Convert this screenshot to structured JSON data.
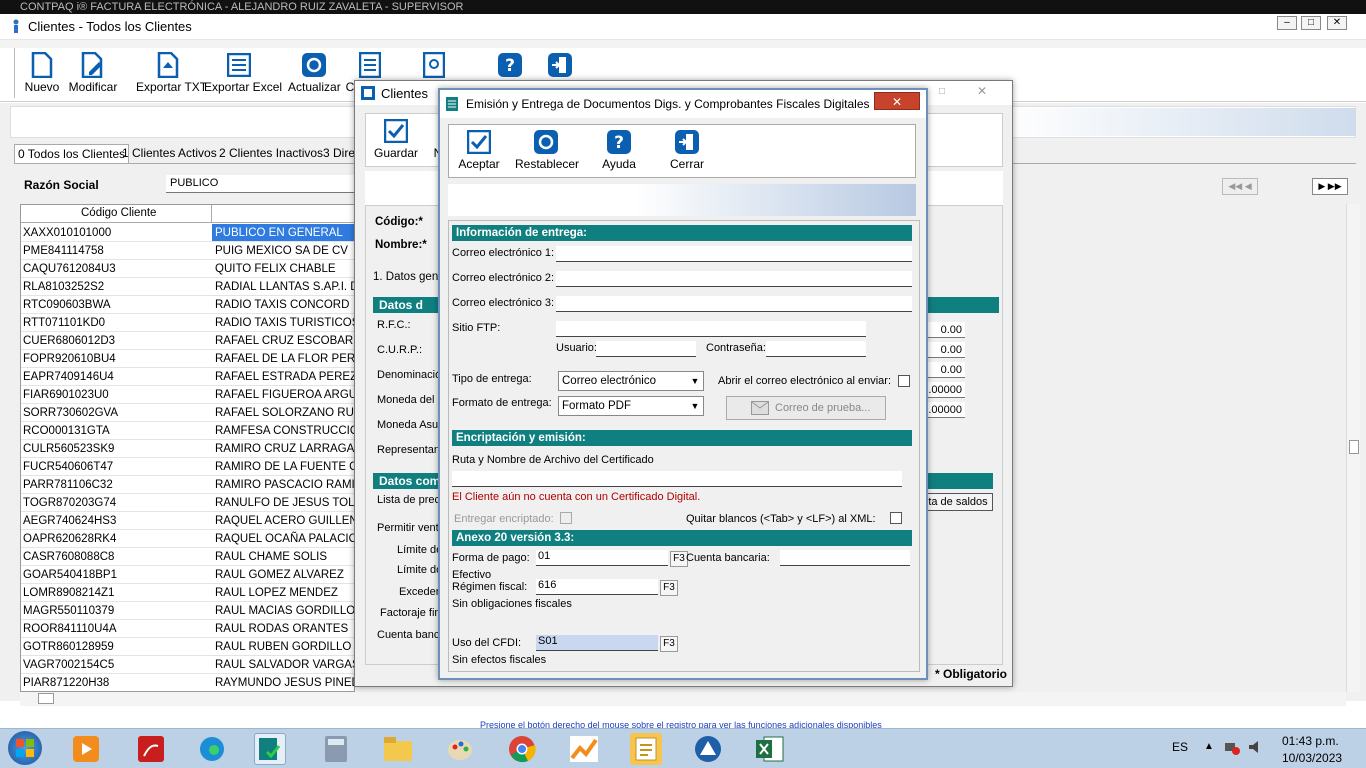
{
  "app": {
    "top_title": "CONTPAQ i® FACTURA ELECTRÓNICA - ALEJANDRO RUIZ ZAVALETA - SUPERVISOR",
    "window_title": "Clientes - Todos los Clientes"
  },
  "toolbar": {
    "nuevo": "Nuevo",
    "modificar": "Modificar",
    "exportar_txt": "Exportar TXT",
    "exportar_excel": "Exportar Excel",
    "actualizar": "Actualizar",
    "c": "C"
  },
  "tabs": [
    "0 Todos los Clientes",
    "1 Clientes Activos",
    "2 Clientes Inactivos",
    "3 Dire"
  ],
  "filter": {
    "label": "Razón Social",
    "value": "PUBLICO"
  },
  "grid": {
    "col1": "Código Cliente",
    "rows": [
      [
        "XAXX010101000",
        "PUBLICO EN GENERAL"
      ],
      [
        "PME841114758",
        "PUIG MEXICO SA DE CV"
      ],
      [
        "CAQU7612084U3",
        "QUITO FELIX CHABLE"
      ],
      [
        "RLA8103252S2",
        "RADIAL LLANTAS S.AP.I. D"
      ],
      [
        "RTC090603BWA",
        "RADIO TAXIS CONCORD"
      ],
      [
        "RTT071101KD0",
        "RADIO TAXIS TURISTICOS"
      ],
      [
        "CUER6806012D3",
        "RAFAEL CRUZ ESCOBAR"
      ],
      [
        "FOPR920610BU4",
        "RAFAEL DE LA FLOR PERE"
      ],
      [
        "EAPR7409146U4",
        "RAFAEL ESTRADA PEREZ"
      ],
      [
        "FIAR6901023U0",
        "RAFAEL FIGUEROA ARGU"
      ],
      [
        "SORR730602GVA",
        "RAFAEL SOLORZANO RUIZ"
      ],
      [
        "RCO000131GTA",
        "RAMFESA CONSTRUCCION"
      ],
      [
        "CULR560523SK9",
        "RAMIRO CRUZ LARRAGA"
      ],
      [
        "FUCR540606T47",
        "RAMIRO DE LA FUENTE CA"
      ],
      [
        "PARR781106C32",
        "RAMIRO PASCACIO RAMIR"
      ],
      [
        "TOGR870203G74",
        "RANULFO DE JESUS TOLE"
      ],
      [
        "AEGR740624HS3",
        "RAQUEL ACERO GUILLEN"
      ],
      [
        "OAPR620628RK4",
        "RAQUEL OCAÑA PALACIOS"
      ],
      [
        "CASR7608088C8",
        "RAUL CHAME SOLIS"
      ],
      [
        "GOAR540418BP1",
        "RAUL GOMEZ ALVAREZ"
      ],
      [
        "LOMR8908214Z1",
        "RAUL LOPEZ MENDEZ"
      ],
      [
        "MAGR550110379",
        "RAUL MACIAS GORDILLO"
      ],
      [
        "ROOR841110U4A",
        "RAUL RODAS ORANTES"
      ],
      [
        "GOTR860128959",
        "RAUL RUBEN GORDILLO T"
      ],
      [
        "VAGR7002154C5",
        "RAUL SALVADOR VARGAS"
      ],
      [
        "PIAR871220H38",
        "RAYMUNDO JESUS PINEDA"
      ]
    ]
  },
  "status": "Presione el botón derecho del mouse sobre el registro para ver las funciones adicionales disponibles",
  "clientes": {
    "title": "Clientes",
    "guardar": "Guardar",
    "n": "N",
    "codigo": "Código:*",
    "nombre": "Nombre:*",
    "tab1": "1. Datos gene",
    "sec1": "Datos d",
    "rfc": "R.F.C.:",
    "curp": "C.U.R.P.:",
    "denominacion": "Denominació",
    "moneda_del": "Moneda del d",
    "moneda_asu": "Moneda Asu",
    "representan": "Representan",
    "sec2": "Datos com",
    "lista_prec": "Lista de prec",
    "permitir": "Permitir vent",
    "limite_de": "Límite de",
    "limite_do": "Límite do",
    "exceder": "Exceder",
    "factoraje": "Factoraje fin",
    "cuenta_banc": "Cuenta banc",
    "nums": [
      "0.00",
      "0.00",
      "0.00",
      ".00000",
      ".00000"
    ],
    "saldos_btn": "ta de saldos",
    "obligatorio": "* Obligatorio"
  },
  "dialog": {
    "title": "Emisión y Entrega de Documentos Digs. y Comprobantes Fiscales Digitales",
    "aceptar": "Aceptar",
    "restablecer": "Restablecer",
    "ayuda": "Ayuda",
    "cerrar": "Cerrar",
    "sec_entrega": "Información de entrega:",
    "correo1": "Correo electrónico 1:",
    "correo2": "Correo electrónico 2:",
    "correo3": "Correo electrónico 3:",
    "sitio_ftp": "Sitio FTP:",
    "usuario": "Usuario:",
    "contrasena": "Contraseña:",
    "tipo_entrega": "Tipo de entrega:",
    "tipo_entrega_val": "Correo electrónico",
    "abrir_correo": "Abrir el correo electrónico al enviar:",
    "formato_entrega": "Formato de entrega:",
    "formato_val": "Formato PDF",
    "correo_prueba": "Correo de prueba...",
    "sec_encrip": "Encriptación y emisión:",
    "ruta_cert": "Ruta y Nombre de Archivo del Certificado",
    "sin_cert": "El Cliente aún no cuenta con un Certificado Digital.",
    "entregar_encrip": "Entregar encriptado:",
    "quitar_blancos": "Quitar blancos (<Tab> y <LF>) al XML:",
    "sec_anexo": "Anexo 20 versión 3.3:",
    "forma_pago": "Forma de pago:",
    "forma_pago_val": "01",
    "forma_pago_desc": "Efectivo",
    "cuenta_bancaria": "Cuenta bancaria:",
    "regimen": "Régimen fiscal:",
    "regimen_val": "616",
    "regimen_desc": "Sin obligaciones fiscales",
    "uso_cfdi": "Uso del CFDI:",
    "uso_val": "S01",
    "uso_desc": "Sin efectos fiscales",
    "f3": "F3"
  },
  "taskbar": {
    "lang": "ES",
    "time": "01:43 p.m.",
    "date": "10/03/2023"
  },
  "colors": {
    "teal": "#0f7f80",
    "blue_icon": "#0b5fb0",
    "selection": "#2f7be0"
  }
}
